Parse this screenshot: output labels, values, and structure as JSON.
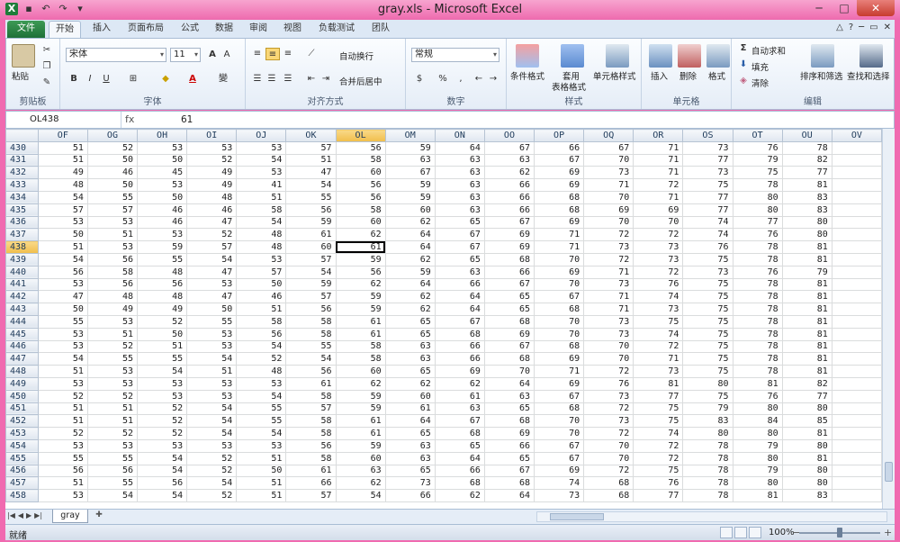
{
  "window": {
    "title": "gray.xls - Microsoft Excel"
  },
  "tabs": [
    {
      "label": "文件"
    },
    {
      "label": "开始"
    },
    {
      "label": "插入"
    },
    {
      "label": "页面布局"
    },
    {
      "label": "公式"
    },
    {
      "label": "数据"
    },
    {
      "label": "审阅"
    },
    {
      "label": "视图"
    },
    {
      "label": "负载测试"
    },
    {
      "label": "团队"
    }
  ],
  "ribbon": {
    "clipboard": {
      "paste": "粘贴",
      "label": "剪贴板"
    },
    "font": {
      "name": "宋体",
      "size": "11",
      "label": "字体",
      "bold": "B",
      "italic": "I",
      "underline": "U",
      "wen": "變"
    },
    "alignment": {
      "wrap": "自动换行",
      "merge": "合并后居中",
      "label": "对齐方式"
    },
    "number": {
      "format": "常规",
      "percent": "%",
      "comma": ",",
      "label": "数字"
    },
    "styles": {
      "conditional": "条件格式",
      "table1": "套用",
      "table2": "表格格式",
      "cell": "单元格样式",
      "label": "样式"
    },
    "cells": {
      "insert": "插入",
      "delete": "删除",
      "format": "格式",
      "label": "单元格"
    },
    "editing": {
      "autosum": "自动求和",
      "fill": "填充",
      "clear": "清除",
      "sort": "排序和筛选",
      "find": "查找和选择",
      "label": "编辑"
    }
  },
  "formula_bar": {
    "name_box": "OL438",
    "fx": "fx",
    "value": "61"
  },
  "sheet": {
    "columns": [
      "OF",
      "OG",
      "OH",
      "OI",
      "OJ",
      "OK",
      "OL",
      "OM",
      "ON",
      "OO",
      "OP",
      "OQ",
      "OR",
      "OS",
      "OT",
      "OU",
      "OV"
    ],
    "selected_column": "OL",
    "selected_row": "438",
    "rows": [
      {
        "r": "430",
        "v": [
          "51",
          "52",
          "53",
          "53",
          "53",
          "57",
          "56",
          "59",
          "64",
          "67",
          "66",
          "67",
          "71",
          "73",
          "76",
          "78",
          ""
        ]
      },
      {
        "r": "431",
        "v": [
          "51",
          "50",
          "50",
          "52",
          "54",
          "51",
          "58",
          "63",
          "63",
          "63",
          "67",
          "70",
          "71",
          "77",
          "79",
          "82",
          ""
        ]
      },
      {
        "r": "432",
        "v": [
          "49",
          "46",
          "45",
          "49",
          "53",
          "47",
          "60",
          "67",
          "63",
          "62",
          "69",
          "73",
          "71",
          "73",
          "75",
          "77",
          ""
        ]
      },
      {
        "r": "433",
        "v": [
          "48",
          "50",
          "53",
          "49",
          "41",
          "54",
          "56",
          "59",
          "63",
          "66",
          "69",
          "71",
          "72",
          "75",
          "78",
          "81",
          ""
        ]
      },
      {
        "r": "434",
        "v": [
          "54",
          "55",
          "50",
          "48",
          "51",
          "55",
          "56",
          "59",
          "63",
          "66",
          "68",
          "70",
          "71",
          "77",
          "80",
          "83",
          ""
        ]
      },
      {
        "r": "435",
        "v": [
          "57",
          "57",
          "46",
          "46",
          "58",
          "56",
          "58",
          "60",
          "63",
          "66",
          "68",
          "69",
          "69",
          "77",
          "80",
          "83",
          ""
        ]
      },
      {
        "r": "436",
        "v": [
          "53",
          "53",
          "46",
          "47",
          "54",
          "59",
          "60",
          "62",
          "65",
          "67",
          "69",
          "70",
          "70",
          "74",
          "77",
          "80",
          ""
        ]
      },
      {
        "r": "437",
        "v": [
          "50",
          "51",
          "53",
          "52",
          "48",
          "61",
          "62",
          "64",
          "67",
          "69",
          "71",
          "72",
          "72",
          "74",
          "76",
          "80",
          ""
        ]
      },
      {
        "r": "438",
        "v": [
          "51",
          "53",
          "59",
          "57",
          "48",
          "60",
          "61",
          "64",
          "67",
          "69",
          "71",
          "73",
          "73",
          "76",
          "78",
          "81",
          ""
        ]
      },
      {
        "r": "439",
        "v": [
          "54",
          "56",
          "55",
          "54",
          "53",
          "57",
          "59",
          "62",
          "65",
          "68",
          "70",
          "72",
          "73",
          "75",
          "78",
          "81",
          ""
        ]
      },
      {
        "r": "440",
        "v": [
          "56",
          "58",
          "48",
          "47",
          "57",
          "54",
          "56",
          "59",
          "63",
          "66",
          "69",
          "71",
          "72",
          "73",
          "76",
          "79",
          ""
        ]
      },
      {
        "r": "441",
        "v": [
          "53",
          "56",
          "56",
          "53",
          "50",
          "59",
          "62",
          "64",
          "66",
          "67",
          "70",
          "73",
          "76",
          "75",
          "78",
          "81",
          ""
        ]
      },
      {
        "r": "442",
        "v": [
          "47",
          "48",
          "48",
          "47",
          "46",
          "57",
          "59",
          "62",
          "64",
          "65",
          "67",
          "71",
          "74",
          "75",
          "78",
          "81",
          ""
        ]
      },
      {
        "r": "443",
        "v": [
          "50",
          "49",
          "49",
          "50",
          "51",
          "56",
          "59",
          "62",
          "64",
          "65",
          "68",
          "71",
          "73",
          "75",
          "78",
          "81",
          ""
        ]
      },
      {
        "r": "444",
        "v": [
          "55",
          "53",
          "52",
          "55",
          "58",
          "58",
          "61",
          "65",
          "67",
          "68",
          "70",
          "73",
          "75",
          "75",
          "78",
          "81",
          ""
        ]
      },
      {
        "r": "445",
        "v": [
          "53",
          "51",
          "50",
          "53",
          "56",
          "58",
          "61",
          "65",
          "68",
          "69",
          "70",
          "73",
          "74",
          "75",
          "78",
          "81",
          ""
        ]
      },
      {
        "r": "446",
        "v": [
          "53",
          "52",
          "51",
          "53",
          "54",
          "55",
          "58",
          "63",
          "66",
          "67",
          "68",
          "70",
          "72",
          "75",
          "78",
          "81",
          ""
        ]
      },
      {
        "r": "447",
        "v": [
          "54",
          "55",
          "55",
          "54",
          "52",
          "54",
          "58",
          "63",
          "66",
          "68",
          "69",
          "70",
          "71",
          "75",
          "78",
          "81",
          ""
        ]
      },
      {
        "r": "448",
        "v": [
          "51",
          "53",
          "54",
          "51",
          "48",
          "56",
          "60",
          "65",
          "69",
          "70",
          "71",
          "72",
          "73",
          "75",
          "78",
          "81",
          ""
        ]
      },
      {
        "r": "449",
        "v": [
          "53",
          "53",
          "53",
          "53",
          "53",
          "61",
          "62",
          "62",
          "62",
          "64",
          "69",
          "76",
          "81",
          "80",
          "81",
          "82",
          ""
        ]
      },
      {
        "r": "450",
        "v": [
          "52",
          "52",
          "53",
          "53",
          "54",
          "58",
          "59",
          "60",
          "61",
          "63",
          "67",
          "73",
          "77",
          "75",
          "76",
          "77",
          ""
        ]
      },
      {
        "r": "451",
        "v": [
          "51",
          "51",
          "52",
          "54",
          "55",
          "57",
          "59",
          "61",
          "63",
          "65",
          "68",
          "72",
          "75",
          "79",
          "80",
          "80",
          ""
        ]
      },
      {
        "r": "452",
        "v": [
          "51",
          "51",
          "52",
          "54",
          "55",
          "58",
          "61",
          "64",
          "67",
          "68",
          "70",
          "73",
          "75",
          "83",
          "84",
          "85",
          ""
        ]
      },
      {
        "r": "453",
        "v": [
          "52",
          "52",
          "52",
          "54",
          "54",
          "58",
          "61",
          "65",
          "68",
          "69",
          "70",
          "72",
          "74",
          "80",
          "80",
          "81",
          ""
        ]
      },
      {
        "r": "454",
        "v": [
          "53",
          "53",
          "53",
          "53",
          "53",
          "56",
          "59",
          "63",
          "65",
          "66",
          "67",
          "70",
          "72",
          "78",
          "79",
          "80",
          ""
        ]
      },
      {
        "r": "455",
        "v": [
          "55",
          "55",
          "54",
          "52",
          "51",
          "58",
          "60",
          "63",
          "64",
          "65",
          "67",
          "70",
          "72",
          "78",
          "80",
          "81",
          ""
        ]
      },
      {
        "r": "456",
        "v": [
          "56",
          "56",
          "54",
          "52",
          "50",
          "61",
          "63",
          "65",
          "66",
          "67",
          "69",
          "72",
          "75",
          "78",
          "79",
          "80",
          ""
        ]
      },
      {
        "r": "457",
        "v": [
          "51",
          "55",
          "56",
          "54",
          "51",
          "66",
          "62",
          "73",
          "68",
          "68",
          "74",
          "68",
          "76",
          "78",
          "80",
          "80",
          ""
        ]
      },
      {
        "r": "458",
        "v": [
          "53",
          "54",
          "54",
          "52",
          "51",
          "57",
          "54",
          "66",
          "62",
          "64",
          "73",
          "68",
          "77",
          "78",
          "81",
          "83",
          ""
        ]
      }
    ],
    "tab": "gray"
  },
  "status": {
    "ready": "就绪",
    "zoom": "100%"
  },
  "colors": {
    "frame": "#f06ab0",
    "file_tab": "#1f7138",
    "selected_header": "#f0be4a"
  }
}
